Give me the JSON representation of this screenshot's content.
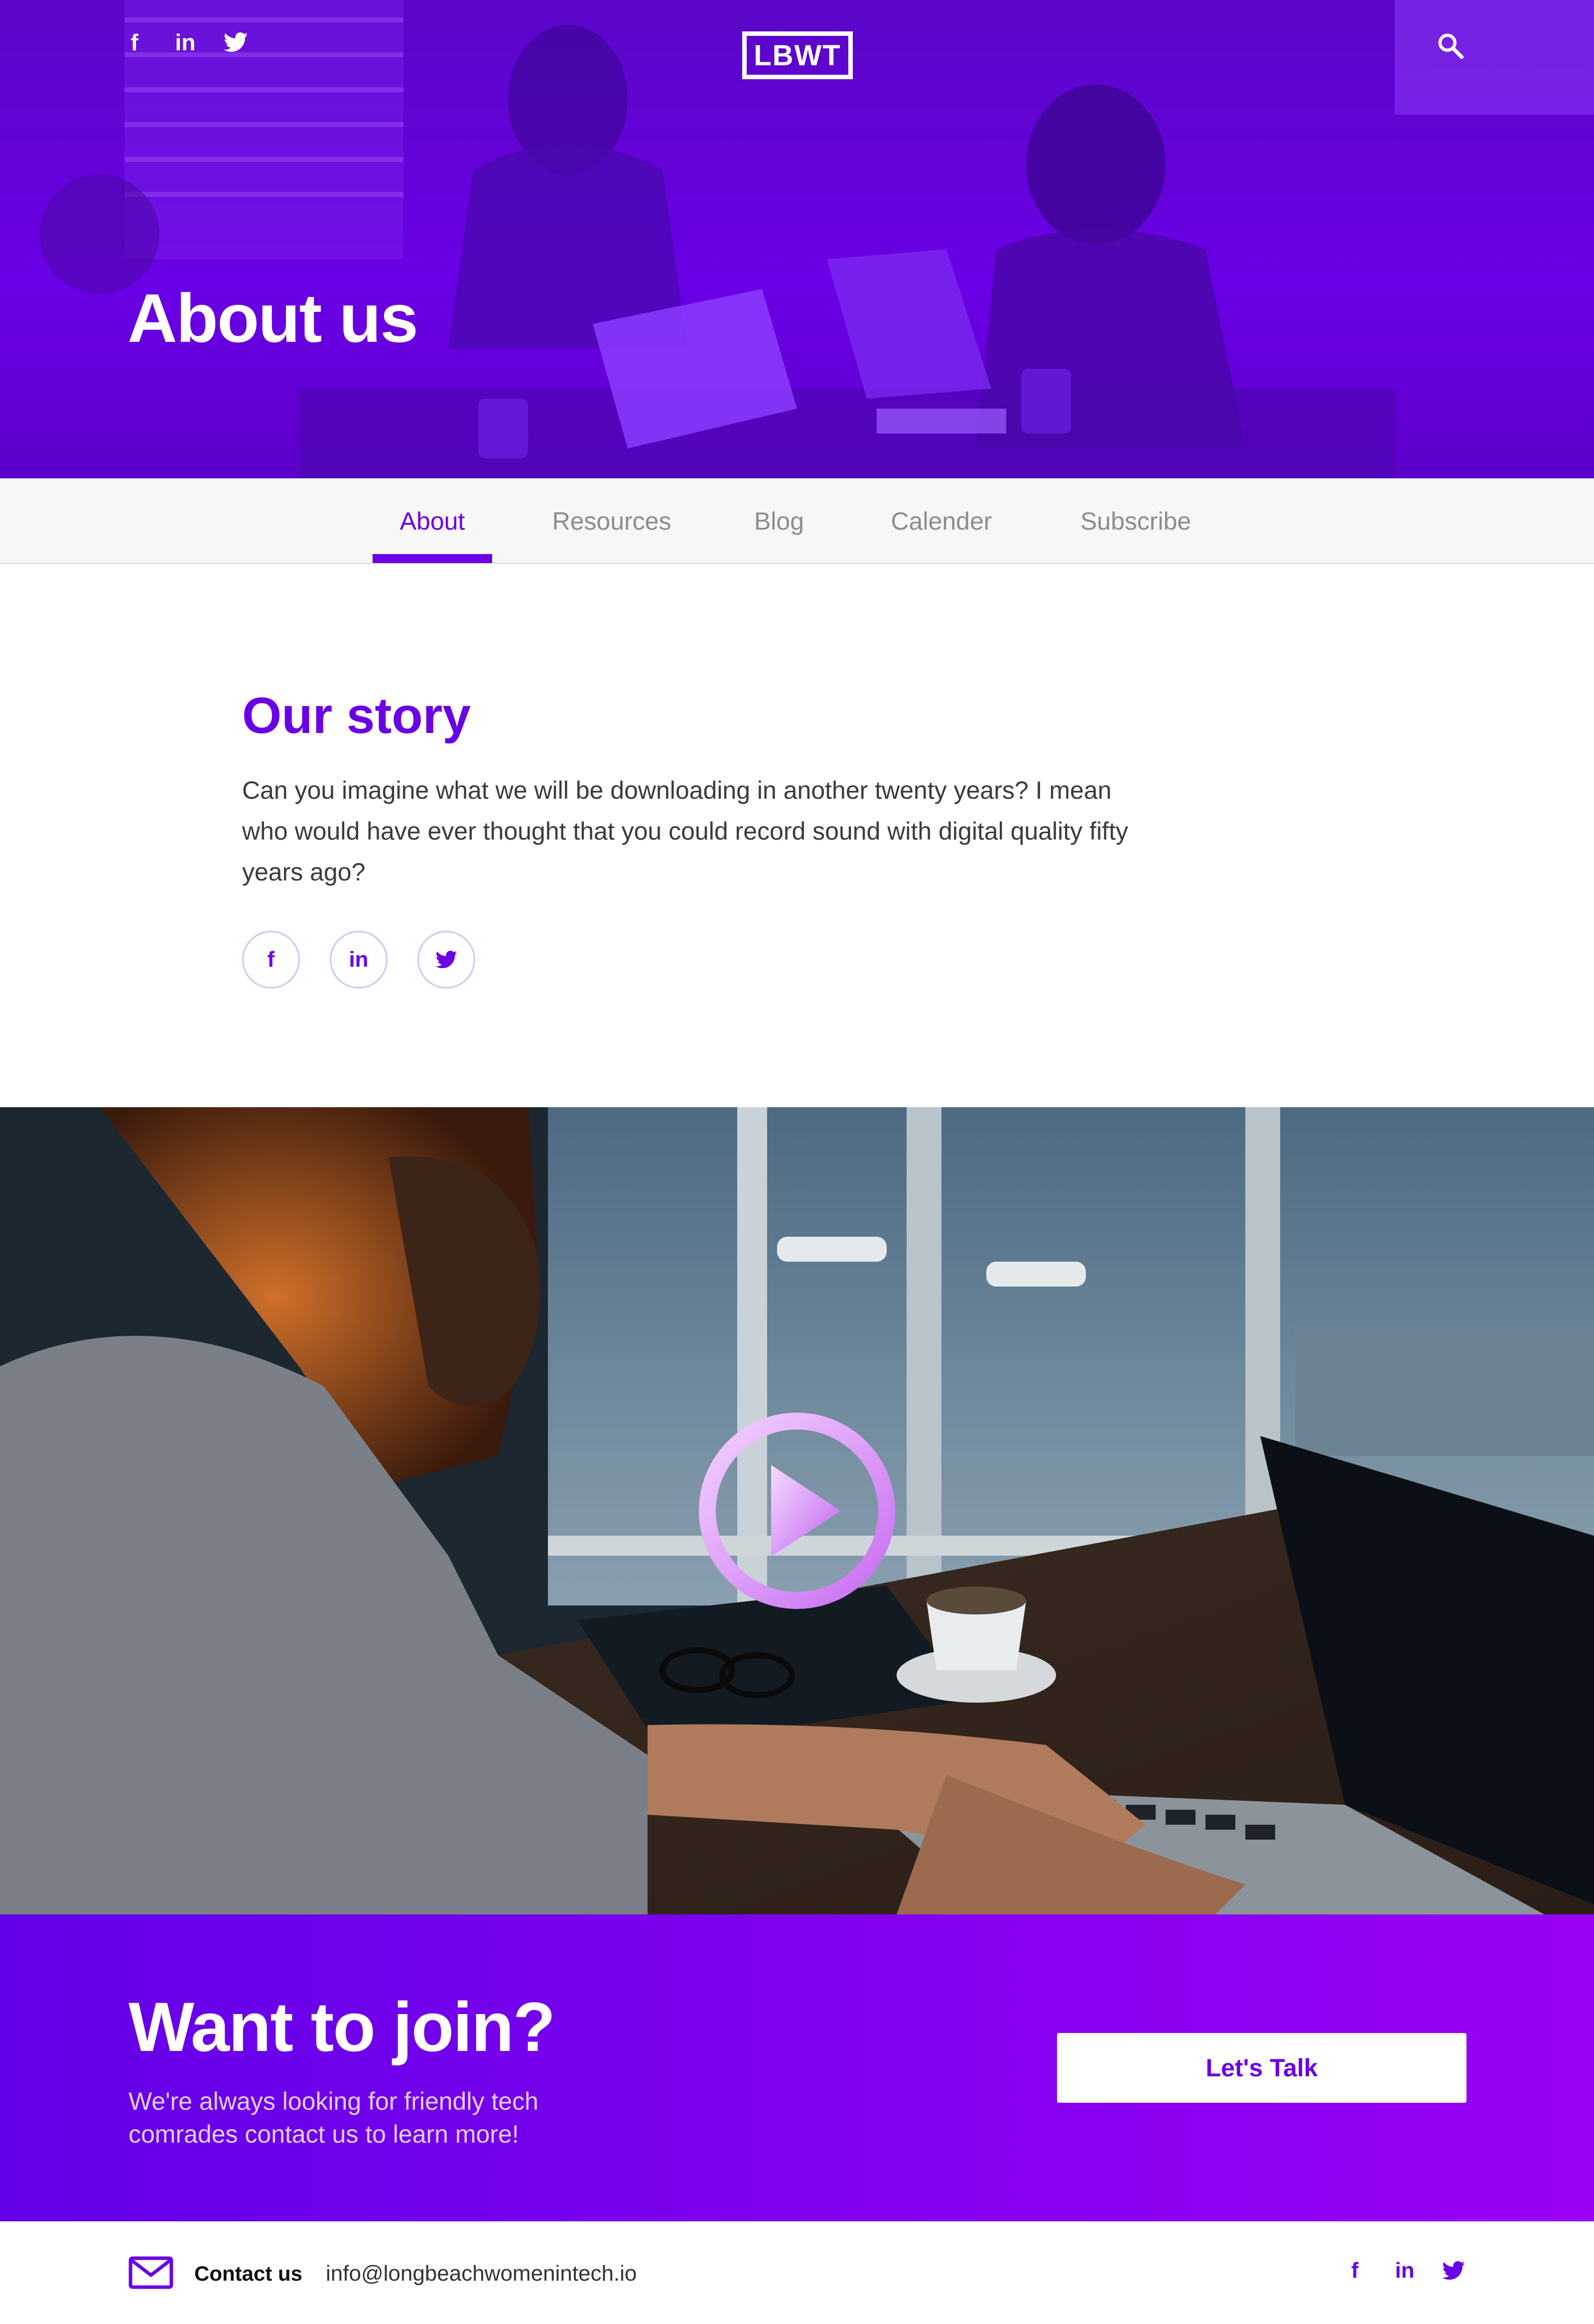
{
  "header": {
    "logo_text": "LBWT",
    "social": [
      {
        "icon": "facebook-icon",
        "glyph": "f"
      },
      {
        "icon": "linkedin-icon",
        "glyph": "in"
      },
      {
        "icon": "twitter-icon",
        "glyph": "🐦"
      }
    ],
    "search_icon": "search-icon"
  },
  "hero": {
    "title": "About us"
  },
  "tabs": [
    {
      "label": "About",
      "active": true
    },
    {
      "label": "Resources",
      "active": false
    },
    {
      "label": "Blog",
      "active": false
    },
    {
      "label": "Calender",
      "active": false
    },
    {
      "label": "Subscribe",
      "active": false
    }
  ],
  "story": {
    "heading": "Our story",
    "text": "Can you imagine what we will be downloading in another twenty years? I mean who would have ever thought that you could record sound with digital quality fifty years ago?",
    "social": [
      {
        "icon": "facebook-icon",
        "glyph": "f"
      },
      {
        "icon": "linkedin-icon",
        "glyph": "in"
      },
      {
        "icon": "twitter-icon",
        "glyph": "🐦"
      }
    ]
  },
  "video": {
    "play_icon": "play-icon"
  },
  "join": {
    "title": "Want to join?",
    "subtitle": "We're always looking for friendly tech comrades contact us to learn more!",
    "button": "Let's Talk"
  },
  "footer": {
    "contact_label": "Contact us",
    "email": "info@longbeachwomenintech.io",
    "mail_icon": "mail-icon",
    "social": [
      {
        "icon": "facebook-icon",
        "glyph": "f"
      },
      {
        "icon": "linkedin-icon",
        "glyph": "in"
      },
      {
        "icon": "twitter-icon",
        "glyph": "🐦"
      }
    ]
  },
  "colors": {
    "brand_purple": "#6a00e6",
    "hero_overlay": "#5b06c8",
    "join_gradient_start": "#6200e8",
    "join_gradient_end": "#9a00f4",
    "tab_inactive": "#8d8d8d"
  }
}
